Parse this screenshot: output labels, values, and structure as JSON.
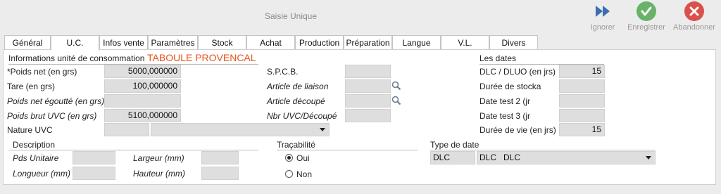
{
  "window": {
    "title": "Saisie Unique"
  },
  "toolbar": {
    "ignore_label": "Ignorer",
    "save_label": "Enregistrer",
    "cancel_label": "Abandonner",
    "ignore_color": "#3a6fb0",
    "save_color": "#68b26a",
    "cancel_color": "#d9514a"
  },
  "tabs": [
    "Général",
    "U.C.",
    "Infos vente",
    "Paramètres",
    "Stock",
    "Achat",
    "Production",
    "Préparation",
    "Langue",
    "V.L.",
    "Divers"
  ],
  "active_tab": "U.C.",
  "uc": {
    "section_title": "Informations unité de consommation",
    "product_name": "TABOULE PROVENCAL",
    "poids_net_label": "*Poids net (en grs)",
    "poids_net_value": "5000,000000",
    "tare_label": "Tare (en grs)",
    "tare_value": "100,000000",
    "poids_egoutte_label": "Poids net égoutté (en grs)",
    "poids_egoutte_value": "",
    "poids_brut_label": "Poids brut UVC (en grs)",
    "poids_brut_value": "5100,000000",
    "nature_label": "Nature UVC",
    "nature_code": "",
    "nature_value": ""
  },
  "middle": {
    "spcb_label": "S.P.C.B.",
    "spcb_value": "",
    "article_liaison_label": "Article de liaison",
    "article_liaison_value": "",
    "article_decoupe_label": "Article découpé",
    "article_decoupe_value": "",
    "nbr_uvc_label": "Nbr UVC/Découpé",
    "nbr_uvc_value": ""
  },
  "dates": {
    "section_title": "Les dates",
    "dlc_label": "DLC / DLUO (en jrs)",
    "dlc_value": "15",
    "duree_stocka_label": "Durée de stocka",
    "duree_stocka_value": "",
    "date_test2_label": "Date test 2 (jr",
    "date_test2_value": "",
    "date_test3_label": "Date test 3 (jr",
    "date_test3_value": "",
    "duree_vie_label": "Durée de vie (en jrs)",
    "duree_vie_value": "15"
  },
  "description": {
    "section_title": "Description",
    "pds_unitaire_label": "Pds Unitaire",
    "pds_unitaire_value": "",
    "longueur_label": "Longueur (mm)",
    "longueur_value": "",
    "largeur_label": "Largeur (mm)",
    "largeur_value": "",
    "hauteur_label": "Hauteur (mm)",
    "hauteur_value": ""
  },
  "tracabilite": {
    "section_title": "Traçabilité",
    "oui_label": "Oui",
    "non_label": "Non",
    "selected": "Oui"
  },
  "type_date": {
    "section_title": "Type de date",
    "code": "DLC",
    "value": "DLC   DLC"
  }
}
